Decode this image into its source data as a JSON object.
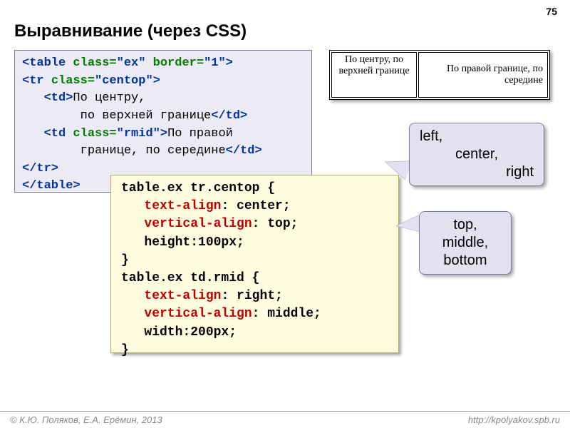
{
  "page_number": "75",
  "title": "Выравнивание (через CSS)",
  "html_code": {
    "l1a": "<table ",
    "l1b": "class=",
    "l1c": "\"ex\" ",
    "l1d": "border=",
    "l1e": "\"1\">",
    "l2a": "<tr ",
    "l2b": "class=",
    "l2c": "\"centop\">",
    "l3a": "   <td>",
    "l3b": "По центру,",
    "l4": "        по верхней границе",
    "l4b": "</td>",
    "l5a": "   <td ",
    "l5b": "class=",
    "l5c": "\"rmid\">",
    "l5d": "По правой",
    "l6": "        границе, по середине",
    "l6b": "</td>",
    "l7": "</tr>",
    "l8": "</table>"
  },
  "demo": {
    "cell1": "По центру, по верхней границе",
    "cell2": "По правой границе, по середине"
  },
  "css_code": {
    "l1": "table.ex tr.centop {",
    "l2a": "   ",
    "l2b": "text-align",
    "l2c": ": center;",
    "l3a": "   ",
    "l3b": "vertical-align",
    "l3c": ": top;",
    "l4": "   height:100px;",
    "l5": "}",
    "l6": "table.ex td.rmid {",
    "l7a": "   ",
    "l7b": "text-align",
    "l7c": ": right;",
    "l8a": "   ",
    "l8b": "vertical-align",
    "l8c": ": middle;",
    "l9": "   width:200px;",
    "l10": "}"
  },
  "callout1": {
    "l1": "left,",
    "l2": "center,",
    "l3": "right"
  },
  "callout2": {
    "l1": "top,",
    "l2": "middle,",
    "l3": "bottom"
  },
  "footer": {
    "left": "© К.Ю. Поляков, Е.А. Ерёмин, 2013",
    "right": "http://kpolyakov.spb.ru"
  }
}
